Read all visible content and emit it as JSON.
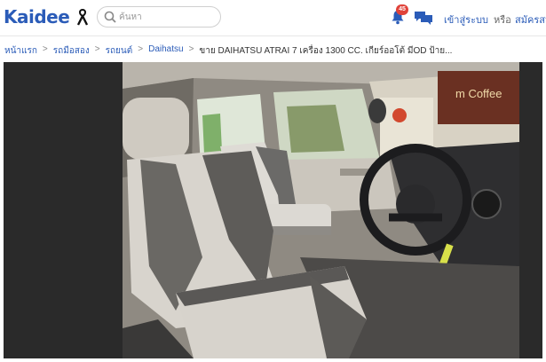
{
  "header": {
    "logo": "Kaidee",
    "search_placeholder": "ค้นหา",
    "notification_count": "45",
    "login_label": "เข้าสู่ระบบ",
    "or_label": "หรือ",
    "signup_label": "สมัครสมาชิก",
    "icons": [
      "mourning-ribbon-icon",
      "search-icon",
      "bell-icon",
      "chat-icon"
    ]
  },
  "breadcrumb": {
    "items": [
      "หน้าแรก",
      "รถมือสอง",
      "รถยนต์",
      "Daihatsu"
    ],
    "current": "ขาย DAIHATSU ATRAI 7 เครื่อง 1300 CC. เกียร์ออโต้ มีOD ป้าย..."
  },
  "gallery": {
    "photo_sign_text": "m Coffee"
  },
  "colors": {
    "brand": "#2b5cb8",
    "badge": "#e0433a",
    "gallery_bg": "#2a2a2a"
  }
}
